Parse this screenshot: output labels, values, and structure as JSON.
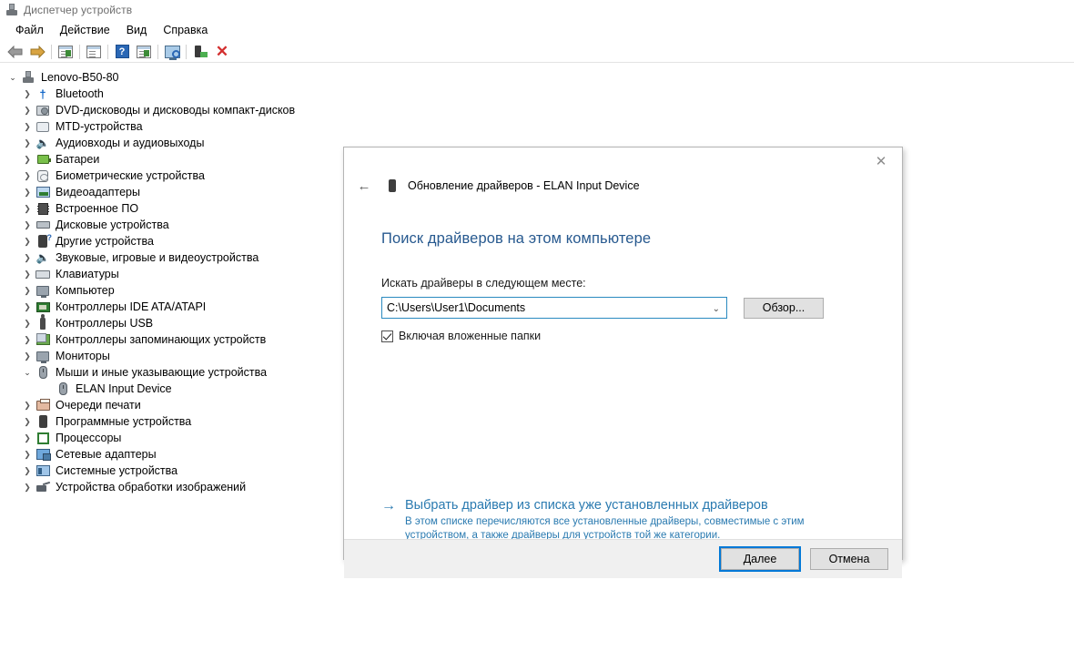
{
  "window": {
    "title": "Диспетчер устройств",
    "icon": "device-manager-icon"
  },
  "menu": {
    "items": [
      {
        "label": "Файл",
        "name": "menu-file"
      },
      {
        "label": "Действие",
        "name": "menu-action"
      },
      {
        "label": "Вид",
        "name": "menu-view"
      },
      {
        "label": "Справка",
        "name": "menu-help"
      }
    ]
  },
  "toolbar": {
    "buttons": [
      {
        "icon": "back-arrow-icon",
        "label": ""
      },
      {
        "icon": "forward-arrow-icon",
        "label": ""
      },
      {
        "icon": "show-hidden-devices-icon",
        "label": ""
      },
      {
        "icon": "properties-icon",
        "label": ""
      },
      {
        "icon": "help-icon",
        "label": "?"
      },
      {
        "icon": "update-driver-icon",
        "label": ""
      },
      {
        "icon": "scan-hardware-changes-icon",
        "label": ""
      },
      {
        "icon": "enable-device-icon",
        "label": ""
      },
      {
        "icon": "uninstall-device-icon",
        "label": "✕"
      }
    ]
  },
  "tree": {
    "root": {
      "label": "Lenovo-B50-80",
      "expanded": true,
      "icon": "computer-icon"
    },
    "items": [
      {
        "label": "Bluetooth",
        "icon": "bluetooth-icon",
        "expanded": false,
        "indent": 1
      },
      {
        "label": "DVD-дисководы и дисководы компакт-дисков",
        "icon": "disc-drive-icon",
        "expanded": false,
        "indent": 1
      },
      {
        "label": "MTD-устройства",
        "icon": "mtd-icon",
        "expanded": false,
        "indent": 1
      },
      {
        "label": "Аудиовходы и аудиовыходы",
        "icon": "audio-icon",
        "expanded": false,
        "indent": 1
      },
      {
        "label": "Батареи",
        "icon": "battery-icon",
        "expanded": false,
        "indent": 1
      },
      {
        "label": "Биометрические устройства",
        "icon": "biometric-icon",
        "expanded": false,
        "indent": 1
      },
      {
        "label": "Видеоадаптеры",
        "icon": "display-adapter-icon",
        "expanded": false,
        "indent": 1
      },
      {
        "label": "Встроенное ПО",
        "icon": "firmware-icon",
        "expanded": false,
        "indent": 1
      },
      {
        "label": "Дисковые устройства",
        "icon": "disk-drive-icon",
        "expanded": false,
        "indent": 1
      },
      {
        "label": "Другие устройства",
        "icon": "other-devices-icon",
        "expanded": false,
        "indent": 1
      },
      {
        "label": "Звуковые, игровые и видеоустройства",
        "icon": "audio-icon",
        "expanded": false,
        "indent": 1
      },
      {
        "label": "Клавиатуры",
        "icon": "keyboard-icon",
        "expanded": false,
        "indent": 1
      },
      {
        "label": "Компьютер",
        "icon": "computer-icon",
        "expanded": false,
        "indent": 1
      },
      {
        "label": "Контроллеры IDE ATA/ATAPI",
        "icon": "ide-controller-icon",
        "expanded": false,
        "indent": 1
      },
      {
        "label": "Контроллеры USB",
        "icon": "usb-controller-icon",
        "expanded": false,
        "indent": 1
      },
      {
        "label": "Контроллеры запоминающих устройств",
        "icon": "storage-controller-icon",
        "expanded": false,
        "indent": 1
      },
      {
        "label": "Мониторы",
        "icon": "monitor-icon",
        "expanded": false,
        "indent": 1
      },
      {
        "label": "Мыши и иные указывающие устройства",
        "icon": "mouse-icon",
        "expanded": true,
        "indent": 1
      },
      {
        "label": "ELAN Input Device",
        "icon": "mouse-icon",
        "expanded": null,
        "indent": 2
      },
      {
        "label": "Очереди печати",
        "icon": "printer-icon",
        "expanded": false,
        "indent": 1
      },
      {
        "label": "Программные устройства",
        "icon": "software-device-icon",
        "expanded": false,
        "indent": 1
      },
      {
        "label": "Процессоры",
        "icon": "processor-icon",
        "expanded": false,
        "indent": 1
      },
      {
        "label": "Сетевые адаптеры",
        "icon": "network-adapter-icon",
        "expanded": false,
        "indent": 1
      },
      {
        "label": "Системные устройства",
        "icon": "system-device-icon",
        "expanded": false,
        "indent": 1
      },
      {
        "label": "Устройства обработки изображений",
        "icon": "imaging-device-icon",
        "expanded": false,
        "indent": 1
      }
    ]
  },
  "dialog": {
    "close_label": "✕",
    "back_label": "←",
    "header_title": "Обновление драйверов - ELAN Input Device",
    "heading": "Поиск драйверов на этом компьютере",
    "path_label": "Искать драйверы в следующем месте:",
    "path_value": "C:\\Users\\User1\\Documents",
    "path_placeholder": "C:\\",
    "dropdown_arrow": "⌄",
    "browse_label": "Обзор...",
    "checkbox_label": "Включая вложенные папки",
    "checkbox_checked": true,
    "link_arrow": "→",
    "link_title": "Выбрать драйвер из списка уже установленных драйверов",
    "link_desc": "В этом списке перечисляются все установленные драйверы, совместимые с этим устройством, а также драйверы для устройств той же категории.",
    "next_label": "Далее",
    "cancel_label": "Отмена"
  },
  "colors": {
    "accent_blue": "#2a7ab0",
    "heading_blue": "#27598f",
    "focus_blue": "#0078d7",
    "combo_border": "#2a8ac0",
    "footer_bg": "#f0f0f0"
  }
}
